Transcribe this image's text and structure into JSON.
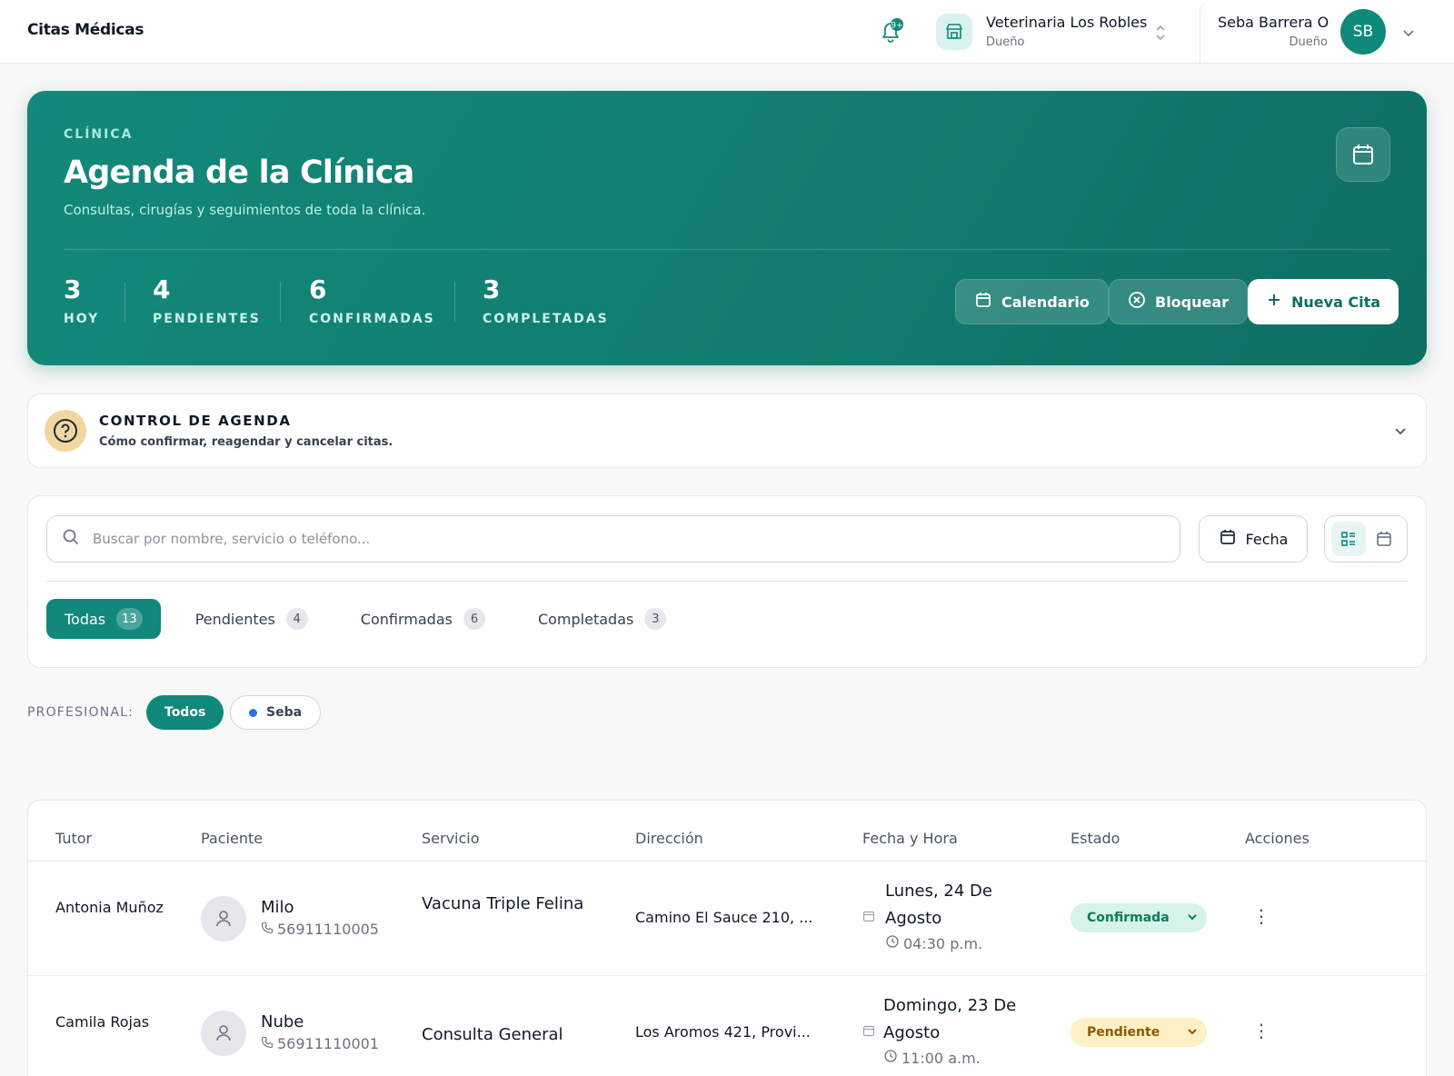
{
  "app": {
    "brand": "Citas Médicas",
    "clinic_name": "Veterinaria Los Robles",
    "clinic_role": "Dueño",
    "user_name": "Seba Barrera O",
    "user_role": "Dueño",
    "user_initials": "SB"
  },
  "hero": {
    "kicker": "CLÍNICA",
    "title": "Agenda de la Clínica",
    "subtitle": "Consultas, cirugías y seguimientos de toda la clínica.",
    "stats": [
      {
        "value": "3",
        "label": "HOY"
      },
      {
        "value": "4",
        "label": "PENDIENTES"
      },
      {
        "value": "6",
        "label": "CONFIRMADAS"
      },
      {
        "value": "3",
        "label": "COMPLETADAS"
      }
    ],
    "buttons": {
      "calendar": "Calendario",
      "block": "Bloquear",
      "new": "Nueva Cita"
    }
  },
  "help": {
    "title": "CONTROL DE AGENDA",
    "subtitle": "Cómo confirmar, reagendar y cancelar citas."
  },
  "filters": {
    "search_placeholder": "Buscar por nombre, servicio o teléfono...",
    "date_label": "Fecha",
    "tabs": [
      {
        "label": "Todas",
        "count": "13"
      },
      {
        "label": "Pendientes",
        "count": "4"
      },
      {
        "label": "Confirmadas",
        "count": "6"
      },
      {
        "label": "Completadas",
        "count": "3"
      }
    ]
  },
  "professional": {
    "label": "PROFESIONAL:",
    "options": [
      "Todos",
      "Seba"
    ]
  },
  "table": {
    "headers": [
      "Tutor",
      "Paciente",
      "Servicio",
      "Dirección",
      "Fecha y Hora",
      "Estado",
      "Acciones"
    ],
    "rows": [
      {
        "tutor": "Antonia Muñoz",
        "patient": "Milo",
        "phone": "56911110005",
        "service": "Vacuna Triple Felina",
        "address": "Camino El Sauce 210, ...",
        "date": "Lunes, 24 De Agosto",
        "time": "04:30 p.m.",
        "status": "Confirmada"
      },
      {
        "tutor": "Camila Rojas",
        "patient": "Nube",
        "phone": "56911110001",
        "service": "Consulta General",
        "address": "Los Aromos 421, Provi...",
        "date": "Domingo, 23 De Agosto",
        "time": "11:00 a.m.",
        "status": "Pendiente"
      }
    ]
  },
  "colors": {
    "accent": "#10887a",
    "confirmed_bg": "#d5f3e7",
    "pending_bg": "#fdf0c4"
  }
}
